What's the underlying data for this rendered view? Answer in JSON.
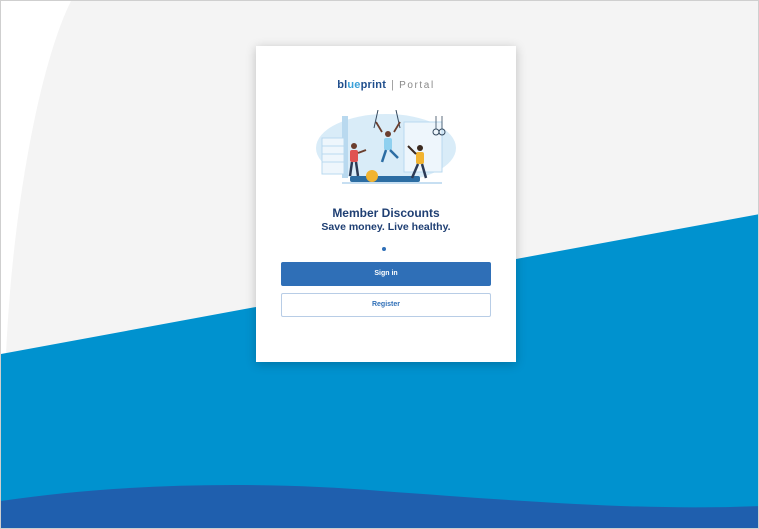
{
  "logo": {
    "brand_prefix": "bl",
    "brand_accent": "ue",
    "brand_suffix": "print",
    "separator": "|",
    "portal": "Portal"
  },
  "hero": {
    "icon": "fitness-illustration"
  },
  "heading": {
    "title": "Member Discounts",
    "subtitle": "Save money. Live healthy."
  },
  "carousel": {
    "active_index": 1,
    "total": 1
  },
  "actions": {
    "sign_in_label": "Sign in",
    "register_label": "Register"
  },
  "colors": {
    "primary": "#2f6fb7",
    "wave_light": "#0092cf",
    "wave_dark": "#1f5fae",
    "title": "#1f3f73",
    "background_gray": "#f4f4f4"
  }
}
